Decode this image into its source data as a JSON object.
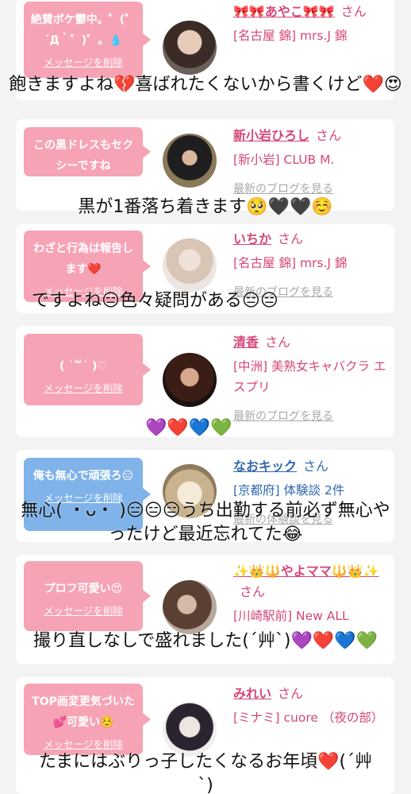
{
  "cards": [
    {
      "bubble_message": "絶賛ボケ鬱中。゜(゜´Д｀゜)゜。💧",
      "bubble_delete": "メッセージを削除",
      "name": "🎀🎀あやこ🎀🎀",
      "san": "さん",
      "shop": "[名古屋 錦] mrs.J 錦",
      "blog": "",
      "bubble_color": "pink"
    },
    {
      "bubble_message": "この黒ドレスもセクシーですね",
      "bubble_delete": "",
      "name": "新小岩ひろし",
      "san": "さん",
      "shop": "[新小岩] CLUB M.",
      "blog": "最新のブログを見る",
      "bubble_color": "pink"
    },
    {
      "bubble_message": "わざと行為は報告します❤️",
      "bubble_delete": "メッセージを削除",
      "name": "いちか",
      "san": "さん",
      "shop": "[名古屋 錦] mrs.J 錦",
      "blog": "最新のブログを見る",
      "bubble_color": "pink"
    },
    {
      "bubble_message": "( ˙꒳˙ )♡",
      "bubble_delete": "メッセージを削除",
      "name": "清香",
      "san": "さん",
      "shop": "[中洲] 美熟女キャバクラ エスプリ",
      "blog": "最新のブログを見る",
      "bubble_color": "pink"
    },
    {
      "bubble_message": "俺も無心で頑張ろ😑",
      "bubble_delete": "メッセージを削除",
      "name": "なおキック",
      "san": "さん",
      "shop": "[京都府] 体験談 2件",
      "blog": "最新の体験談を見る",
      "bubble_color": "blue"
    },
    {
      "bubble_message": "プロフ可愛い😍",
      "bubble_delete": "メッセージを削除",
      "name": "✨👑🔱やよママ🔱👑✨",
      "san": "さん",
      "shop": "[川崎駅前] New ALL",
      "blog": "",
      "bubble_color": "pink"
    },
    {
      "bubble_message": "TOP画変更気づいた💕可愛い☺️",
      "bubble_delete": "メッセージを削除",
      "name": "みれい",
      "san": "さん",
      "shop": "[ミナミ] cuore （夜の部）",
      "blog": "",
      "bubble_color": "pink"
    }
  ],
  "overlays": [
    "飽きますよね💔喜ばれたくないから書くけど❤️😍",
    "黒が1番落ち着きます🥺🖤🖤☺️",
    "ですよね😑色々疑問がある😑😑",
    "💜❤️💙💚",
    "無心( ・ᴗ・ )😑😑😑うち出勤する前必ず無心やったけど最近忘れてた😂",
    "撮り直しなしで盛れました(´艸`)💜❤️💙💚",
    "たまにはぶりっ子したくなるお年頃❤️(´艸`)"
  ],
  "colors": {
    "pink_bubble": "#f7a3b6",
    "blue_bubble": "#7fb3ea",
    "name_pink": "#d6457a",
    "name_blue": "#2f68ad",
    "background": "#f3f3f3"
  }
}
